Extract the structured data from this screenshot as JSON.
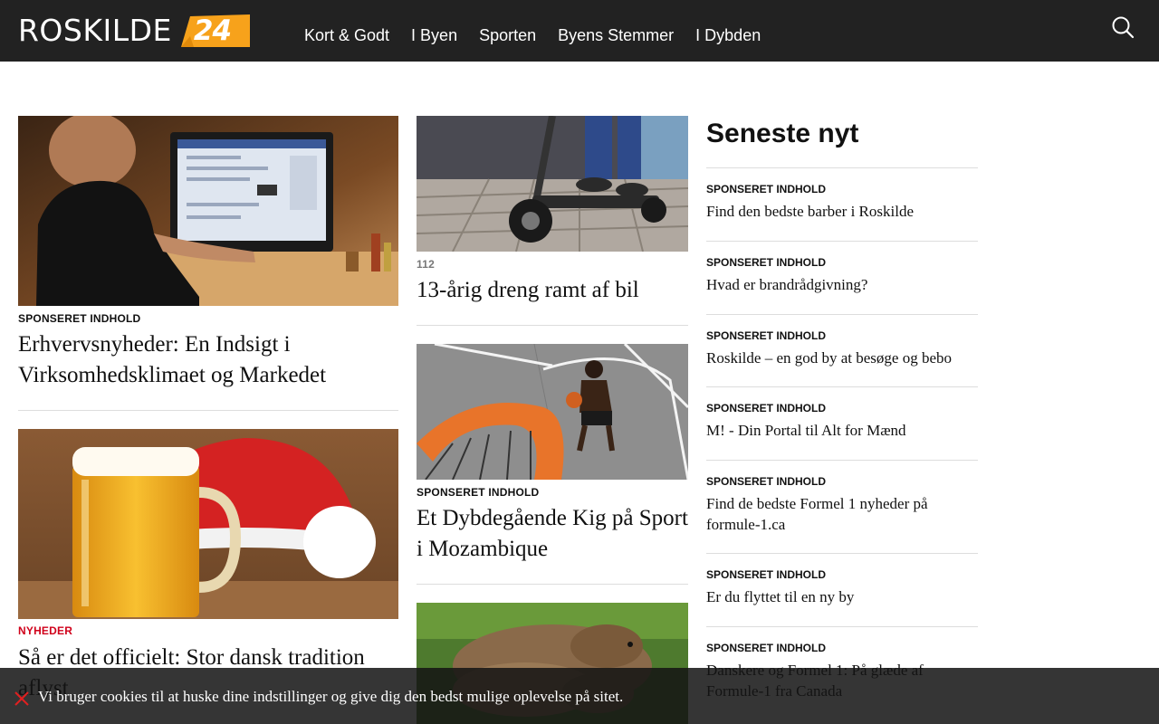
{
  "header": {
    "logo_text": "ROSKILDE",
    "logo_number": "24",
    "nav": [
      "Kort & Godt",
      "I Byen",
      "Sporten",
      "Byens Stemmer",
      "I Dybden"
    ],
    "search_icon": "search-icon"
  },
  "articles": [
    {
      "kicker": "SPONSERET INDHOLD",
      "title": "Erhvervsnyheder: En Indsigt i Virksomhedsklimaet og Markedet",
      "image": "person at computer"
    },
    {
      "kicker": "NYHEDER",
      "title": "Så er det officielt: Stor dansk tradition aflyst",
      "image": "beer mug and santa hat"
    },
    {
      "kicker": "112",
      "title": "13-årig dreng ramt af bil",
      "image": "electric scooter"
    },
    {
      "kicker": "SPONSERET INDHOLD",
      "title": "Et Dybdegående Kig på Sport i Mozambique",
      "image": "basketball court"
    },
    {
      "kicker": "",
      "title": "",
      "image": "capybaras"
    }
  ],
  "sidebar": {
    "title": "Seneste nyt",
    "items": [
      {
        "kicker": "SPONSERET INDHOLD",
        "title": "Find den bedste barber i Roskilde"
      },
      {
        "kicker": "SPONSERET INDHOLD",
        "title": "Hvad er brandrådgivning?"
      },
      {
        "kicker": "SPONSERET INDHOLD",
        "title": "Roskilde – en god by at besøge og bebo"
      },
      {
        "kicker": "SPONSERET INDHOLD",
        "title": "M! - Din Portal til Alt for Mænd"
      },
      {
        "kicker": "SPONSERET INDHOLD",
        "title": "Find de bedste Formel 1 nyheder på formule-1.ca"
      },
      {
        "kicker": "SPONSERET INDHOLD",
        "title": "Er du flyttet til en ny by"
      },
      {
        "kicker": "SPONSERET INDHOLD",
        "title": "Danskere og Formel 1: På glæde af Formule-1 fra Canada"
      }
    ]
  },
  "cookie": {
    "text": "Vi bruger cookies til at huske dine indstillinger og give dig den bedst mulige oplevelse på sitet.",
    "close_icon": "close-icon"
  },
  "colors": {
    "header_bg": "#222222",
    "brand_orange": "#f7a21b",
    "news_red": "#d0021b",
    "meta_gray": "#777777"
  }
}
